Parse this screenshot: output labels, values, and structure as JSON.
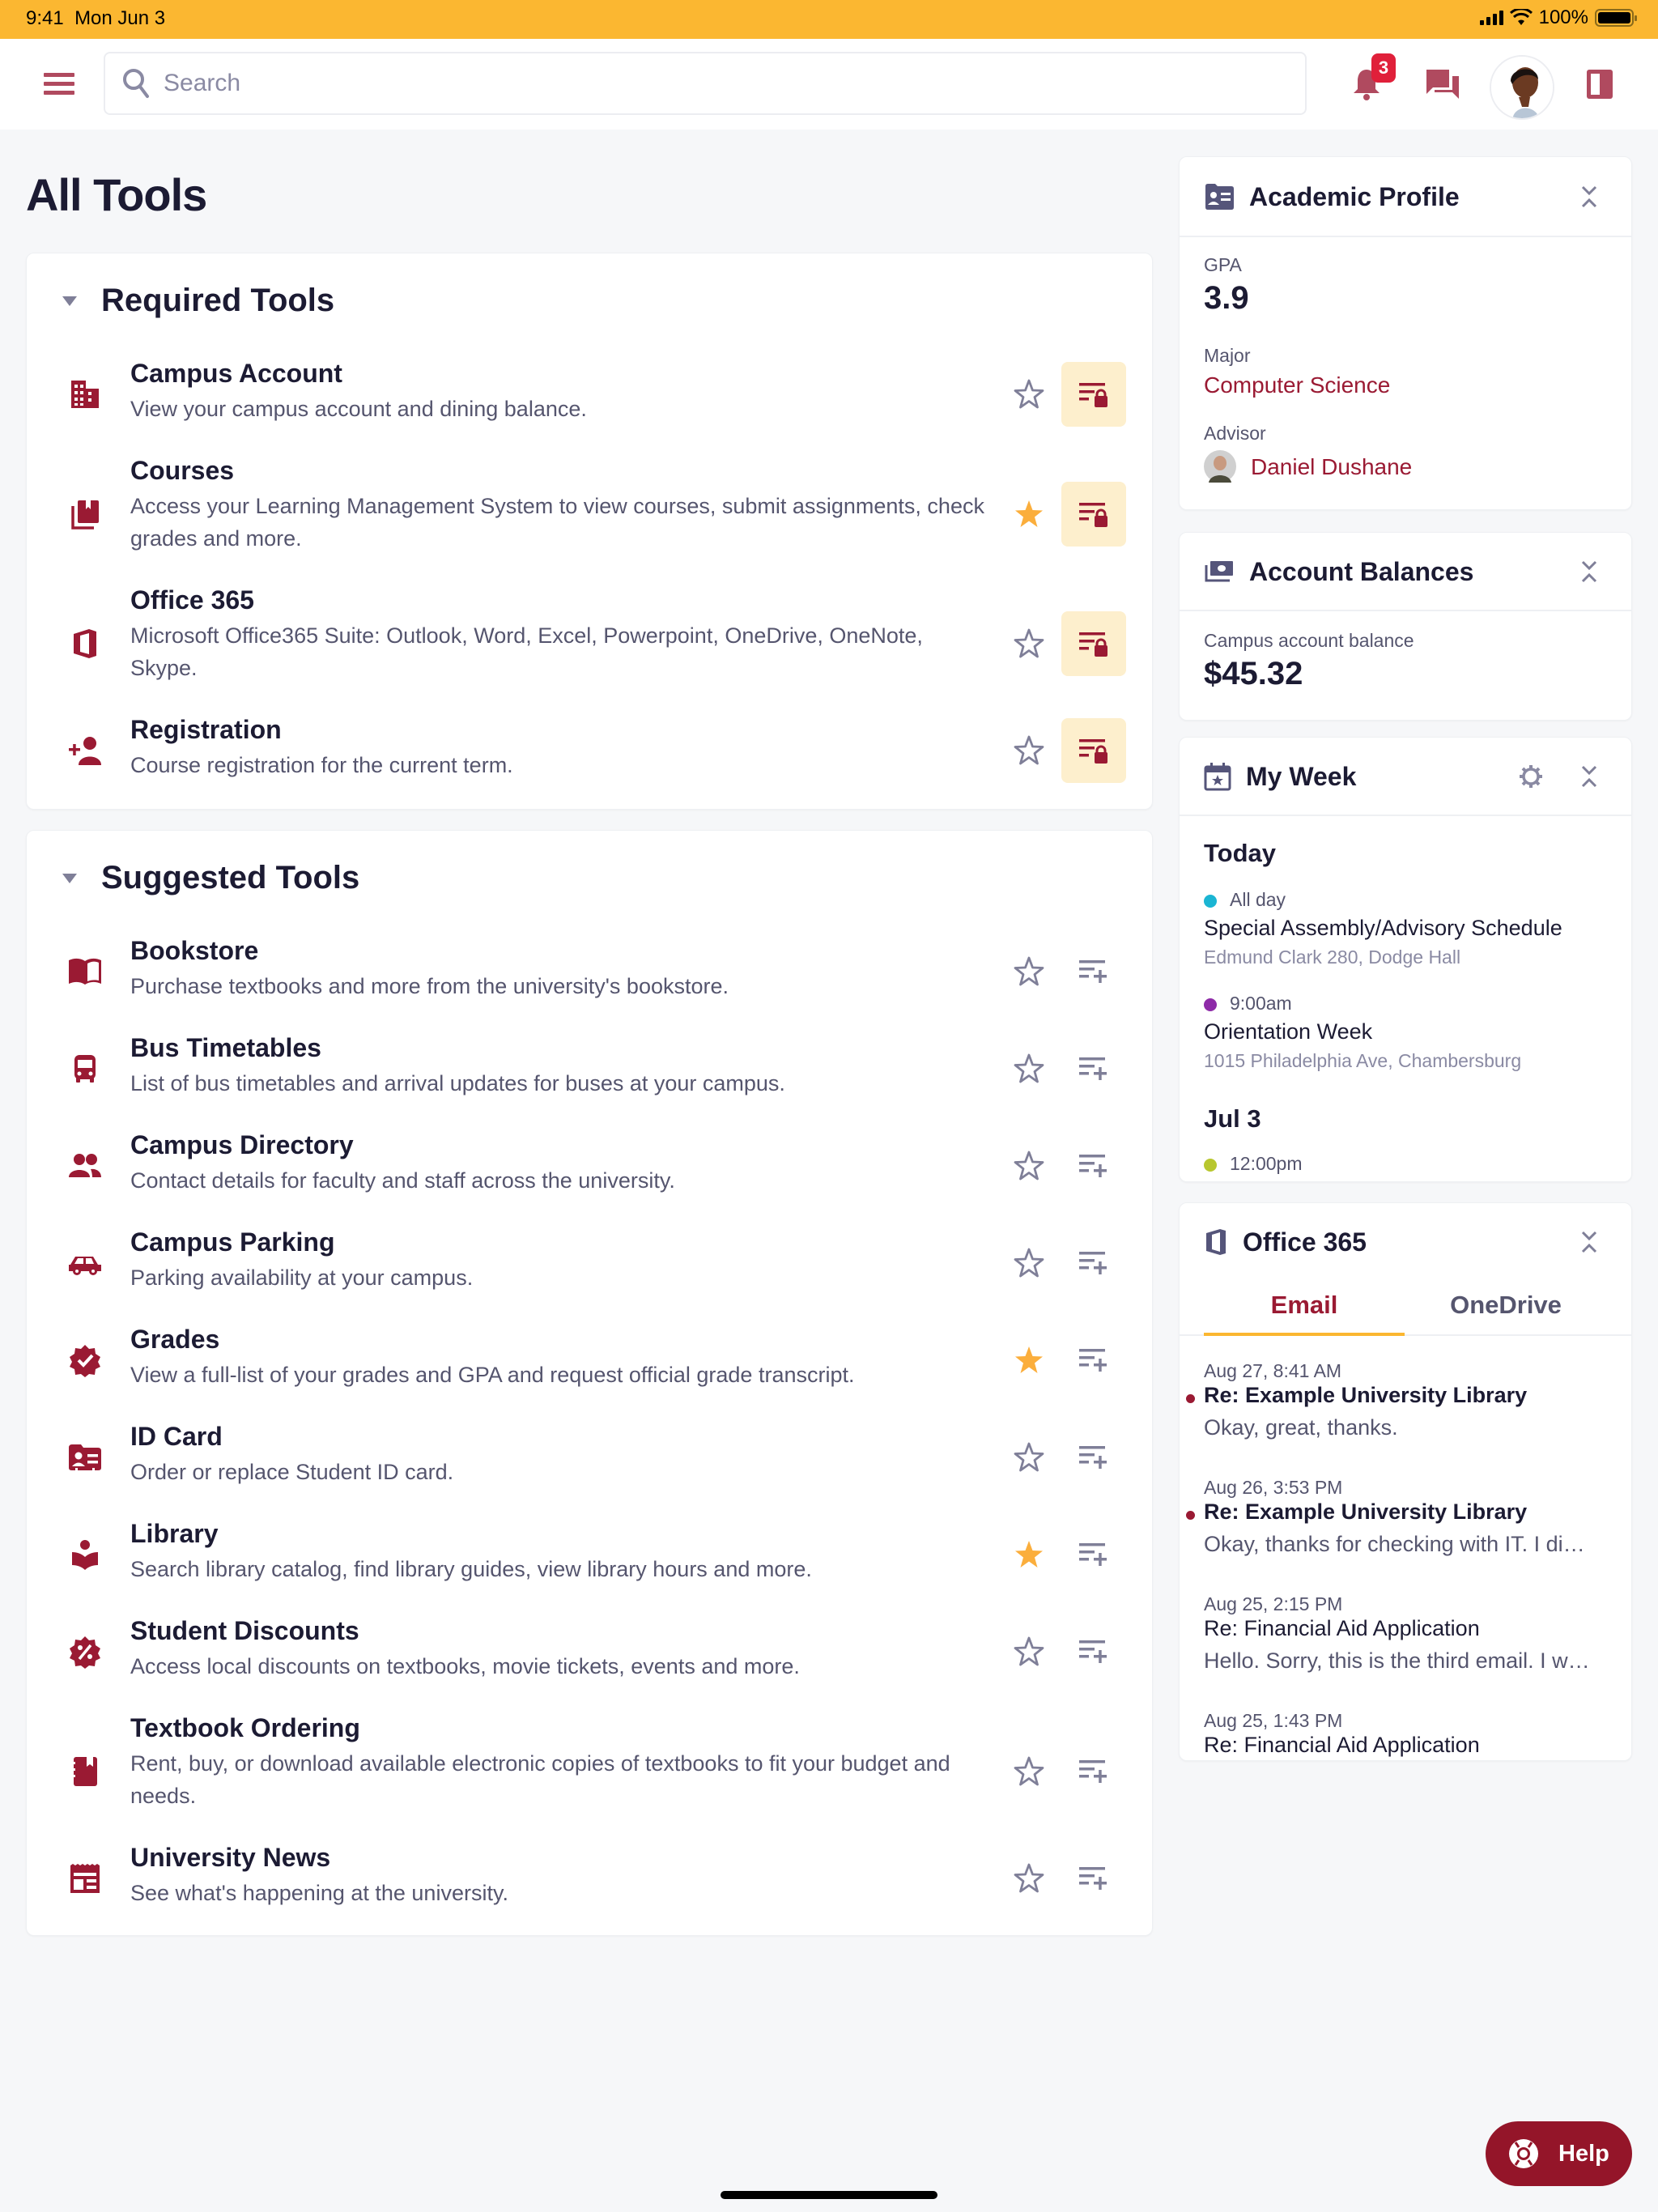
{
  "status_bar": {
    "time": "9:41",
    "date": "Mon Jun 3",
    "battery": "100%",
    "colors": {
      "bar": "#FBB731"
    }
  },
  "header": {
    "search_placeholder": "Search",
    "notifications_count": "3",
    "icons": [
      "menu-icon",
      "search-icon",
      "bell-icon",
      "chat-icon",
      "avatar",
      "side-panel-icon"
    ]
  },
  "page": {
    "title": "All Tools"
  },
  "theme": {
    "brand": "#9A1A33",
    "accent": "#FBB731",
    "star_active": "#FBAE3C",
    "star_inactive": "#7F7F98",
    "locked_bg": "#FDEFCD",
    "background": "#F6F7F9"
  },
  "required": {
    "label": "Required Tools",
    "tools": [
      {
        "name": "Campus Account",
        "desc": "View your campus account and dining balance.",
        "icon": "building-icon",
        "favorite": false,
        "action": "locked"
      },
      {
        "name": "Courses",
        "desc": "Access your Learning Management System to view courses, submit assignments, check grades and more.",
        "icon": "library-books-icon",
        "favorite": true,
        "action": "locked"
      },
      {
        "name": "Office 365",
        "desc": "Microsoft Office365 Suite: Outlook, Word, Excel, Powerpoint, OneDrive, OneNote, Skype.",
        "icon": "office-icon",
        "favorite": false,
        "action": "locked"
      },
      {
        "name": "Registration",
        "desc": "Course registration for the current term.",
        "icon": "person-add-icon",
        "favorite": false,
        "action": "locked"
      }
    ]
  },
  "suggested": {
    "label": "Suggested Tools",
    "tools": [
      {
        "name": "Bookstore",
        "desc": "Purchase textbooks and more from the university's bookstore.",
        "icon": "book-open-icon",
        "favorite": false,
        "action": "add"
      },
      {
        "name": "Bus Timetables",
        "desc": "List of bus timetables and arrival updates for buses at your campus.",
        "icon": "bus-icon",
        "favorite": false,
        "action": "add"
      },
      {
        "name": "Campus Directory",
        "desc": "Contact details for faculty and staff across the university.",
        "icon": "people-icon",
        "favorite": false,
        "action": "add"
      },
      {
        "name": "Campus Parking",
        "desc": "Parking availability at your campus.",
        "icon": "car-icon",
        "favorite": false,
        "action": "add"
      },
      {
        "name": "Grades",
        "desc": "View a full-list of your grades and GPA and request official grade transcript.",
        "icon": "verified-badge-icon",
        "favorite": true,
        "action": "add"
      },
      {
        "name": "ID Card",
        "desc": "Order or replace Student ID card.",
        "icon": "id-card-icon",
        "favorite": false,
        "action": "add"
      },
      {
        "name": "Library",
        "desc": "Search library catalog, find library guides, view library hours and more.",
        "icon": "reader-icon",
        "favorite": true,
        "action": "add"
      },
      {
        "name": "Student Discounts",
        "desc": "Access local discounts on textbooks, movie tickets, events and more.",
        "icon": "discount-icon",
        "favorite": false,
        "action": "add"
      },
      {
        "name": "Textbook Ordering",
        "desc": "Rent, buy, or download available electronic copies of textbooks to fit your budget and needs.",
        "icon": "notebook-icon",
        "favorite": false,
        "action": "add"
      },
      {
        "name": "University News",
        "desc": "See what's happening at the university.",
        "icon": "newspaper-icon",
        "favorite": false,
        "action": "add"
      }
    ]
  },
  "academic_profile": {
    "title": "Academic Profile",
    "gpa_label": "GPA",
    "gpa": "3.9",
    "major_label": "Major",
    "major": "Computer Science",
    "advisor_label": "Advisor",
    "advisor": "Daniel Dushane"
  },
  "account_balances": {
    "title": "Account Balances",
    "label": "Campus account balance",
    "value": "$45.32"
  },
  "my_week": {
    "title": "My Week",
    "days": [
      {
        "label": "Today",
        "events": [
          {
            "time": "All day",
            "title": "Special Assembly/Advisory Schedule",
            "location": "Edmund Clark 280, Dodge Hall",
            "color": "#1BB5D3"
          },
          {
            "time": "9:00am",
            "title": "Orientation Week",
            "location": "1015 Philadelphia Ave, Chambersburg",
            "color": "#8E2BA8"
          }
        ]
      },
      {
        "label": "Jul 3",
        "events": [
          {
            "time": "12:00pm",
            "color": "#B8C72F"
          }
        ]
      }
    ]
  },
  "office365": {
    "title": "Office 365",
    "tabs": [
      {
        "label": "Email",
        "active": true
      },
      {
        "label": "OneDrive",
        "active": false
      }
    ],
    "emails": [
      {
        "date": "Aug 27, 8:41 AM",
        "subject": "Re: Example University Library",
        "preview": "Okay, great, thanks.",
        "unread": true
      },
      {
        "date": "Aug 26, 3:53 PM",
        "subject": "Re: Example University Library",
        "preview": "Okay, thanks for checking with IT. I di…",
        "unread": true
      },
      {
        "date": "Aug 25, 2:15 PM",
        "subject": "Re: Financial Aid Application",
        "preview": "Hello. Sorry, this is the third email. I w…",
        "unread": false
      },
      {
        "date": "Aug 25, 1:43 PM",
        "subject": "Re: Financial Aid Application",
        "preview": "",
        "unread": false
      }
    ]
  },
  "help": {
    "label": "Help"
  }
}
